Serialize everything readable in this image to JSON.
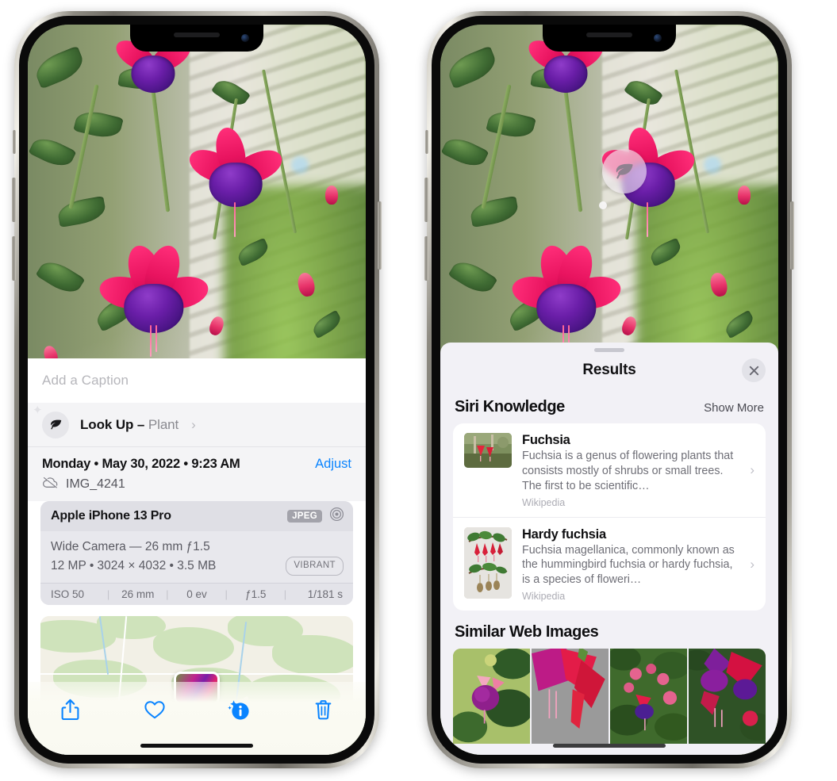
{
  "left_phone": {
    "caption": {
      "placeholder": "Add a Caption"
    },
    "lookup": {
      "label": "Look Up –",
      "subject": "Plant",
      "icon": "leaf-icon",
      "chevron": "›"
    },
    "meta": {
      "date": "Monday • May 30, 2022 • 9:23 AM",
      "adjust_label": "Adjust",
      "filename": "IMG_4241",
      "cloud_icon": "cloud-slash-icon"
    },
    "camera_card": {
      "device": "Apple iPhone 13 Pro",
      "format_badge": "JPEG",
      "aperture_icon": "aperture-icon",
      "lens_line": "Wide Camera — 26 mm ƒ1.5",
      "spec_line": "12 MP • 3024 × 4032 • 3.5 MB",
      "style_badge": "VIBRANT",
      "exif": [
        "ISO 50",
        "26 mm",
        "0 ev",
        "ƒ1.5",
        "1/181 s"
      ]
    },
    "toolbar": [
      {
        "name": "share-button",
        "icon": "share-icon"
      },
      {
        "name": "favorite-button",
        "icon": "heart-icon"
      },
      {
        "name": "info-button",
        "icon": "info-sparkle-icon"
      },
      {
        "name": "delete-button",
        "icon": "trash-icon"
      }
    ],
    "accent_color": "#0a84ff"
  },
  "right_phone": {
    "visual_lookup_badge": {
      "icon": "leaf-icon"
    },
    "sheet": {
      "title": "Results",
      "close_icon": "close-icon",
      "sections": [
        {
          "title": "Siri Knowledge",
          "action": "Show More",
          "items": [
            {
              "title": "Fuchsia",
              "description": "Fuchsia is a genus of flowering plants that consists mostly of shrubs or small trees. The first to be scientific…",
              "source": "Wikipedia",
              "chevron": "›"
            },
            {
              "title": "Hardy fuchsia",
              "description": "Fuchsia magellanica, commonly known as the hummingbird fuchsia or hardy fuchsia, is a species of floweri…",
              "source": "Wikipedia",
              "chevron": "›"
            }
          ]
        },
        {
          "title": "Similar Web Images",
          "images": [
            {
              "alt": "fuchsia-web-image-1"
            },
            {
              "alt": "fuchsia-web-image-2"
            },
            {
              "alt": "fuchsia-web-image-3"
            },
            {
              "alt": "fuchsia-web-image-4"
            }
          ]
        }
      ]
    }
  }
}
